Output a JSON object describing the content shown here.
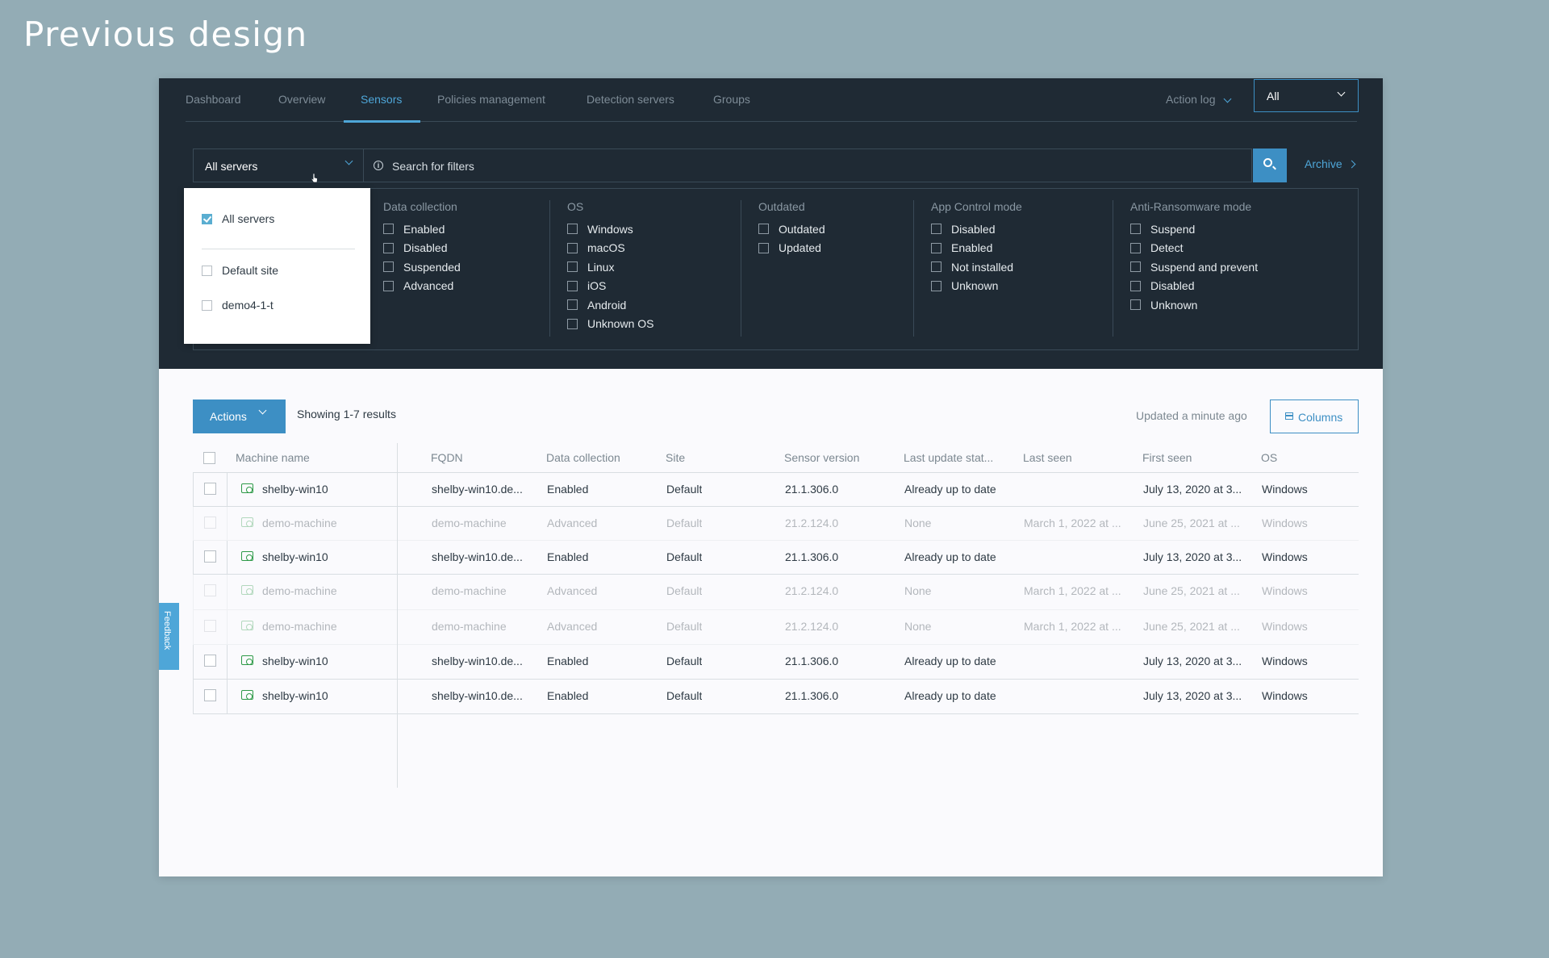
{
  "page": {
    "title": "Previous design"
  },
  "nav": {
    "tabs": [
      {
        "label": "Dashboard",
        "active": false
      },
      {
        "label": "Overview",
        "active": false
      },
      {
        "label": "Sensors",
        "active": true
      },
      {
        "label": "Policies management",
        "active": false
      },
      {
        "label": "Detection servers",
        "active": false
      },
      {
        "label": "Groups",
        "active": false
      }
    ],
    "action_log": "Action log",
    "scope_value": "All"
  },
  "search": {
    "server_select_value": "All servers",
    "placeholder": "Search for filters",
    "archive": "Archive"
  },
  "server_dropdown": {
    "options": [
      {
        "label": "All servers",
        "checked": true
      },
      {
        "label": "Default site",
        "checked": false
      },
      {
        "label": "demo4-1-t",
        "checked": false
      }
    ]
  },
  "filters": {
    "data_collection": {
      "title": "Data collection",
      "options": [
        "Enabled",
        "Disabled",
        "Suspended",
        "Advanced"
      ]
    },
    "os": {
      "title": "OS",
      "options": [
        "Windows",
        "macOS",
        "Linux",
        "iOS",
        "Android",
        "Unknown OS"
      ]
    },
    "outdated": {
      "title": "Outdated",
      "options": [
        "Outdated",
        "Updated"
      ]
    },
    "app_control": {
      "title": "App Control mode",
      "options": [
        "Disabled",
        "Enabled",
        "Not installed",
        "Unknown"
      ]
    },
    "anti_ransomware": {
      "title": "Anti-Ransomware mode",
      "options": [
        "Suspend",
        "Detect",
        "Suspend and prevent",
        "Disabled",
        "Unknown"
      ]
    }
  },
  "toolbar": {
    "actions": "Actions",
    "showing": "Showing 1-7 results",
    "updated": "Updated a minute ago",
    "columns": "Columns"
  },
  "table": {
    "headers": [
      "Machine name",
      "FQDN",
      "Data collection",
      "Site",
      "Sensor version",
      "Last update stat...",
      "Last seen",
      "First seen",
      "OS"
    ],
    "rows": [
      {
        "name": "shelby-win10",
        "fqdn": "shelby-win10.de...",
        "data_collection": "Enabled",
        "site": "Default",
        "version": "21.1.306.0",
        "last_update": "Already up to date",
        "last_seen": "",
        "first_seen": "July 13, 2020 at 3...",
        "os": "Windows",
        "faded": false
      },
      {
        "name": "demo-machine",
        "fqdn": "demo-machine",
        "data_collection": "Advanced",
        "site": "Default",
        "version": "21.2.124.0",
        "last_update": "None",
        "last_seen": "March 1, 2022 at ...",
        "first_seen": "June 25, 2021 at ...",
        "os": "Windows",
        "faded": true
      },
      {
        "name": "shelby-win10",
        "fqdn": "shelby-win10.de...",
        "data_collection": "Enabled",
        "site": "Default",
        "version": "21.1.306.0",
        "last_update": "Already up to date",
        "last_seen": "",
        "first_seen": "July 13, 2020 at 3...",
        "os": "Windows",
        "faded": false
      },
      {
        "name": "demo-machine",
        "fqdn": "demo-machine",
        "data_collection": "Advanced",
        "site": "Default",
        "version": "21.2.124.0",
        "last_update": "None",
        "last_seen": "March 1, 2022 at ...",
        "first_seen": "June 25, 2021 at ...",
        "os": "Windows",
        "faded": true
      },
      {
        "name": "demo-machine",
        "fqdn": "demo-machine",
        "data_collection": "Advanced",
        "site": "Default",
        "version": "21.2.124.0",
        "last_update": "None",
        "last_seen": "March 1, 2022 at ...",
        "first_seen": "June 25, 2021 at ...",
        "os": "Windows",
        "faded": true
      },
      {
        "name": "shelby-win10",
        "fqdn": "shelby-win10.de...",
        "data_collection": "Enabled",
        "site": "Default",
        "version": "21.1.306.0",
        "last_update": "Already up to date",
        "last_seen": "",
        "first_seen": "July 13, 2020 at 3...",
        "os": "Windows",
        "faded": false
      },
      {
        "name": "shelby-win10",
        "fqdn": "shelby-win10.de...",
        "data_collection": "Enabled",
        "site": "Default",
        "version": "21.1.306.0",
        "last_update": "Already up to date",
        "last_seen": "",
        "first_seen": "July 13, 2020 at 3...",
        "os": "Windows",
        "faded": false
      }
    ]
  },
  "feedback": {
    "label": "Feedback"
  }
}
